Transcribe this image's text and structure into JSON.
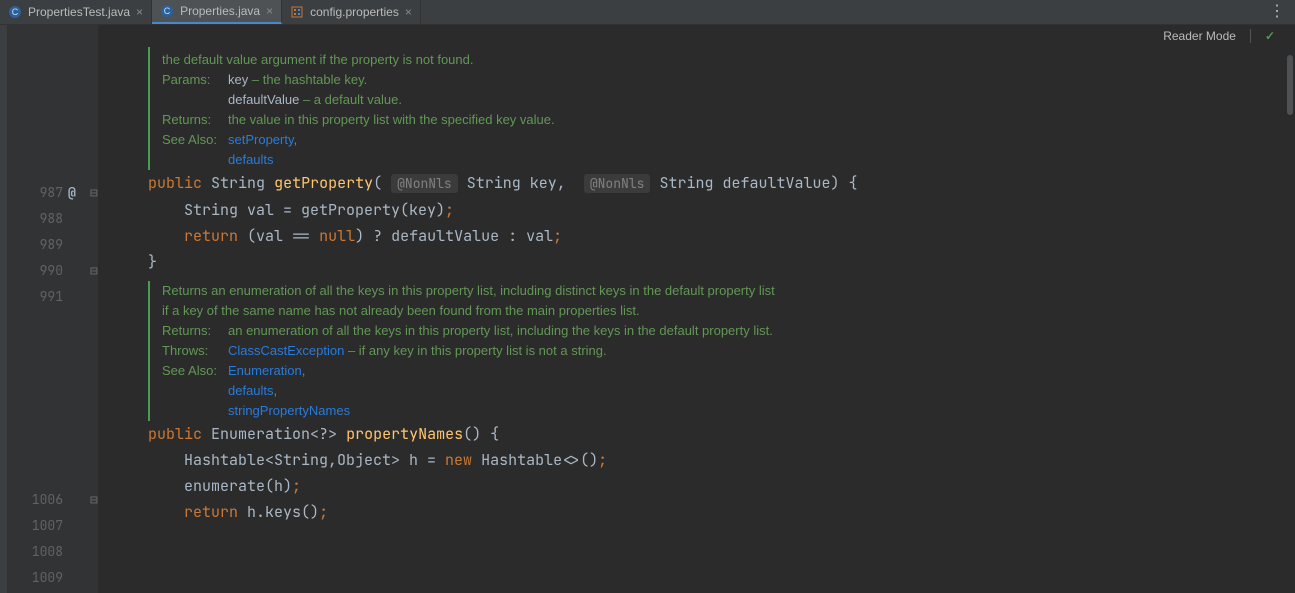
{
  "tabs": [
    {
      "label": "PropertiesTest.java",
      "icon": "java-class-icon",
      "active": false
    },
    {
      "label": "Properties.java",
      "icon": "java-class-icon",
      "active": true
    },
    {
      "label": "config.properties",
      "icon": "properties-file-icon",
      "active": false
    }
  ],
  "reader_mode_label": "Reader Mode",
  "gutter_lines": [
    "987",
    "988",
    "989",
    "990",
    "991",
    "1006",
    "1007",
    "1008",
    "1009"
  ],
  "docs": {
    "getProperty": {
      "summary_tail": "property list, the default property list, and its defaults, recursively, are then checked. The method returns the default value argument if the property is not found.",
      "params_label": "Params:",
      "params": [
        {
          "name": "key",
          "desc": "– the hashtable key."
        },
        {
          "name": "defaultValue",
          "desc": "– a default value."
        }
      ],
      "returns_label": "Returns:",
      "returns": "the value in this property list with the specified key value.",
      "seealso_label": "See Also:",
      "seealso": [
        "setProperty",
        "defaults"
      ]
    },
    "propertyNames": {
      "summary": "Returns an enumeration of all the keys in this property list, including distinct keys in the default property list if a key of the same name has not already been found from the main properties list.",
      "returns_label": "Returns:",
      "returns": "an enumeration of all the keys in this property list, including the keys in the default property list.",
      "throws_label": "Throws:",
      "throws_link": "ClassCastException",
      "throws_tail": " – if any key in this property list is not a string.",
      "seealso_label": "See Also:",
      "seealso": [
        "Enumeration",
        "defaults",
        "stringPropertyNames"
      ]
    }
  },
  "code": {
    "kw_public": "public",
    "kw_return": "return",
    "kw_new": "new",
    "kw_null": "null",
    "type_String": "String",
    "type_Enum": "Enumeration",
    "type_Hashtable": "Hashtable",
    "type_Object": "Object",
    "ann_NonNls": "@NonNls",
    "m1_name": "getProperty",
    "m1_p1": "key",
    "m1_p2": "defaultValue",
    "m1_l2_a": "String val = getProperty(key)",
    "m1_l3_a": "(val == ",
    "m1_l3_b": ") ? defaultValue : val",
    "m2_name": "propertyNames",
    "m2_sig_tail": "<?>",
    "m2_l1_a": "<String,Object> h = ",
    "m2_l1_b": "<>()",
    "m2_l2": "enumerate(h)",
    "m2_l3": "h.keys()"
  }
}
